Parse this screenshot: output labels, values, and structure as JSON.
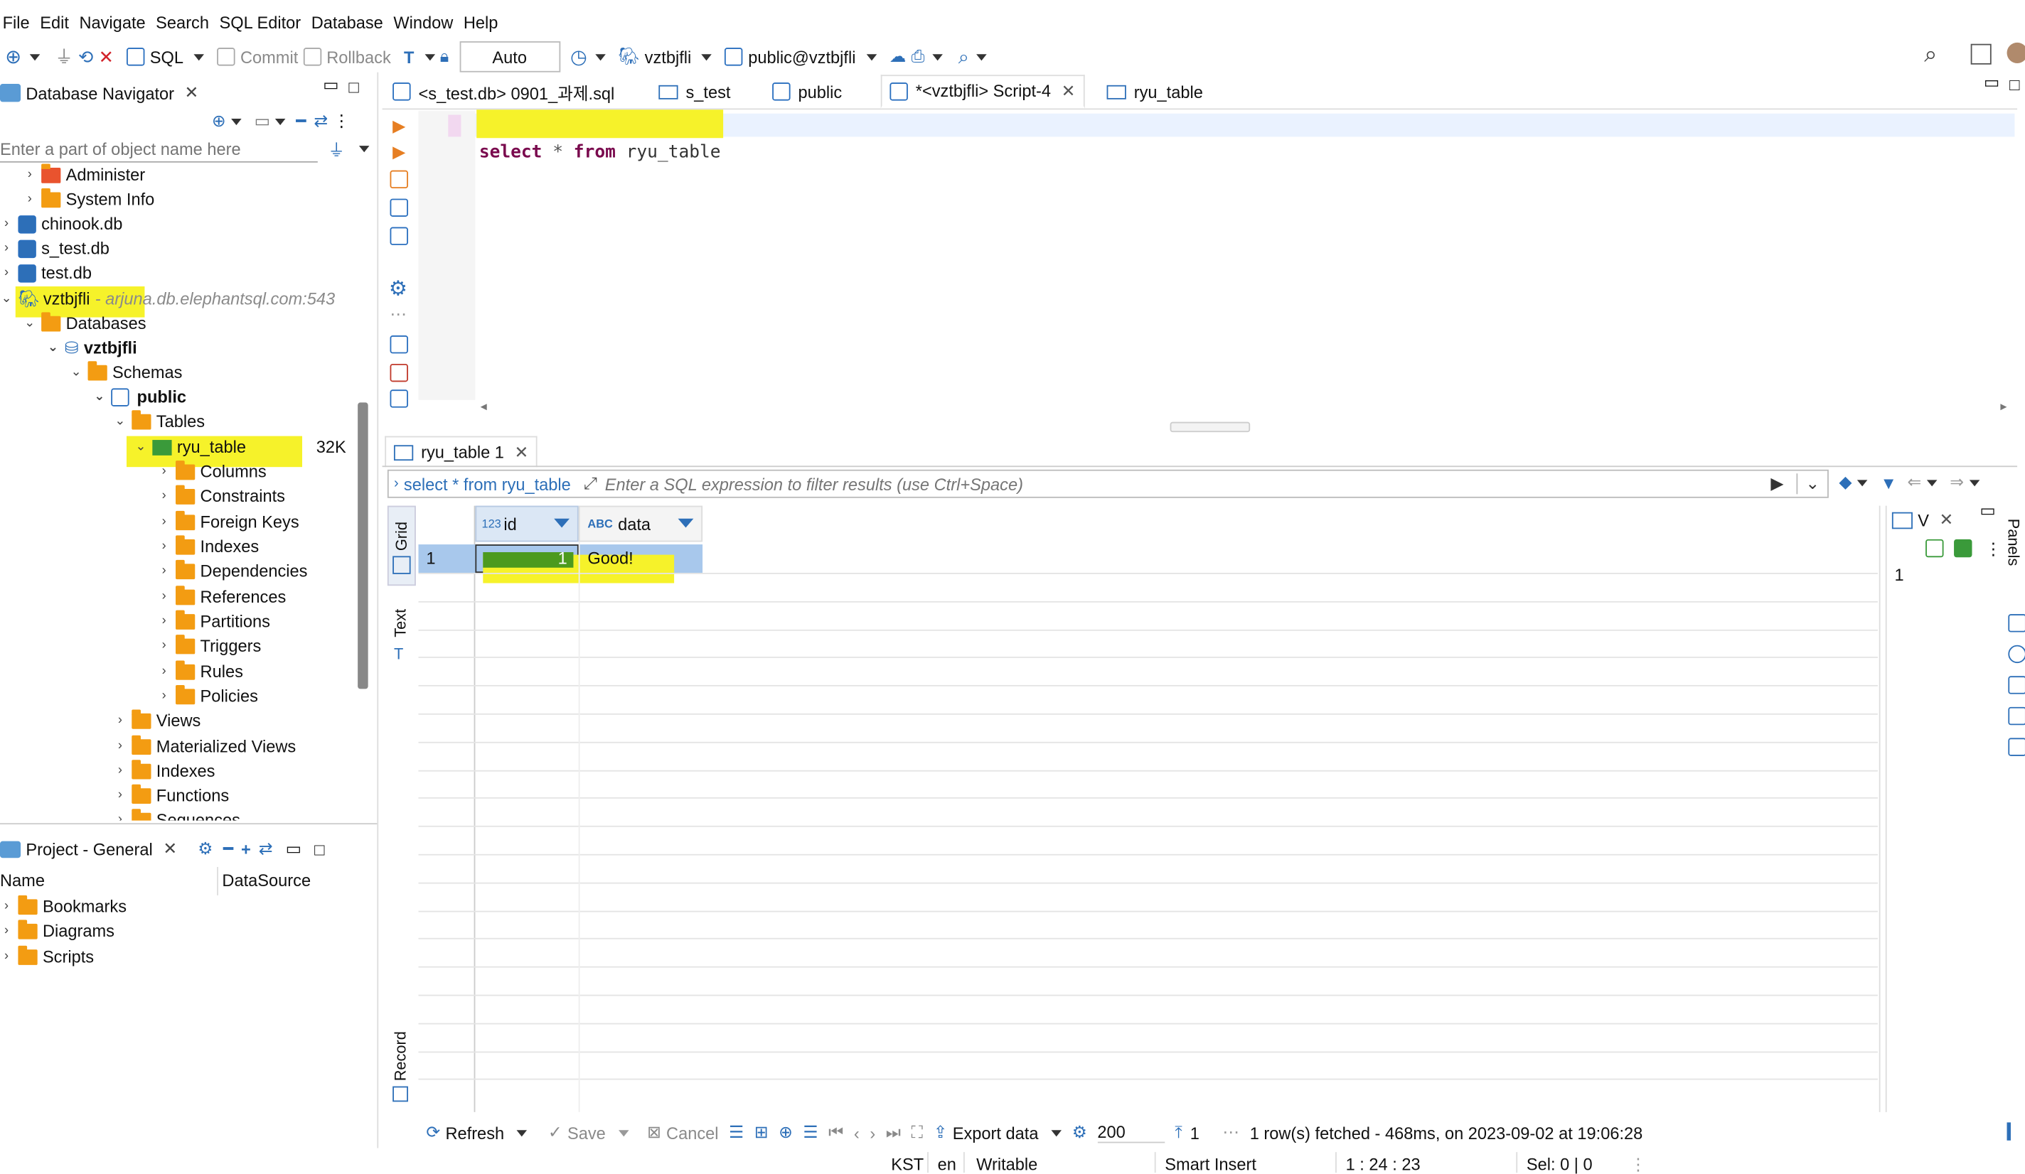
{
  "menu": [
    "File",
    "Edit",
    "Navigate",
    "Search",
    "SQL Editor",
    "Database",
    "Window",
    "Help"
  ],
  "toolbar": {
    "sql_label": "SQL",
    "commit_label": "Commit",
    "rollback_label": "Rollback",
    "transaction_mode": "Auto",
    "datasource": "vztbjfli",
    "schema": "public@vztbjfli"
  },
  "navigator": {
    "title": "Database Navigator",
    "search_placeholder": "Enter a part of object name here",
    "items": [
      {
        "label": "Administer"
      },
      {
        "label": "System Info"
      },
      {
        "label": "chinook.db"
      },
      {
        "label": "s_test.db"
      },
      {
        "label": "test.db"
      },
      {
        "label": "vztbjfli",
        "host": " - arjuna.db.elephantsql.com:543"
      },
      {
        "label": "Databases"
      },
      {
        "label": "vztbjfli"
      },
      {
        "label": "Schemas"
      },
      {
        "label": "public"
      },
      {
        "label": "Tables"
      },
      {
        "label": "ryu_table",
        "size": "32K"
      },
      {
        "label": "Columns"
      },
      {
        "label": "Constraints"
      },
      {
        "label": "Foreign Keys"
      },
      {
        "label": "Indexes"
      },
      {
        "label": "Dependencies"
      },
      {
        "label": "References"
      },
      {
        "label": "Partitions"
      },
      {
        "label": "Triggers"
      },
      {
        "label": "Rules"
      },
      {
        "label": "Policies"
      },
      {
        "label": "Views"
      },
      {
        "label": "Materialized Views"
      },
      {
        "label": "Indexes"
      },
      {
        "label": "Functions"
      },
      {
        "label": "Sequences"
      }
    ]
  },
  "project": {
    "title": "Project - General",
    "col_name": "Name",
    "col_datasource": "DataSource",
    "items": [
      "Bookmarks",
      "Diagrams",
      "Scripts"
    ]
  },
  "editor_tabs": [
    {
      "label": "<s_test.db> 0901_과제.sql"
    },
    {
      "label": "s_test"
    },
    {
      "label": "public"
    },
    {
      "label": "*<vztbjfli> Script-4"
    },
    {
      "label": "ryu_table"
    }
  ],
  "editor": {
    "kw_select": "select",
    "kw_star": "*",
    "kw_from": "from",
    "ident": "ryu_table"
  },
  "results": {
    "tab_label": "ryu_table 1",
    "query_label": "select * from ryu_table",
    "filter_placeholder": "Enter a SQL expression to filter results (use Ctrl+Space)",
    "side_grid": "Grid",
    "side_text": "Text",
    "side_record": "Record",
    "columns": [
      {
        "type": "123",
        "name": "id"
      },
      {
        "type": "ABC",
        "name": "data"
      }
    ],
    "rows": [
      {
        "num": "1",
        "id": "1",
        "data": "Good!"
      }
    ],
    "value_panel_title": "V",
    "value_panel_value": "1",
    "panels_label": "Panels"
  },
  "bottom_toolbar": {
    "refresh": "Refresh",
    "save": "Save",
    "cancel": "Cancel",
    "export": "Export data",
    "fetch_size": "200",
    "row_count": "1",
    "status_msg": "1 row(s) fetched - 468ms, on 2023-09-02 at 19:06:28"
  },
  "statusbar": {
    "timezone": "KST",
    "locale": "en",
    "mode": "Writable",
    "insert": "Smart Insert",
    "position": "1 : 24 : 23",
    "selection": "Sel: 0 | 0"
  },
  "colors": {
    "highlight": "#f6f22a",
    "selection": "#a8c8ec",
    "accent": "#2d6fb8",
    "folder": "#f39c12",
    "keyword": "#7a0a4e"
  }
}
